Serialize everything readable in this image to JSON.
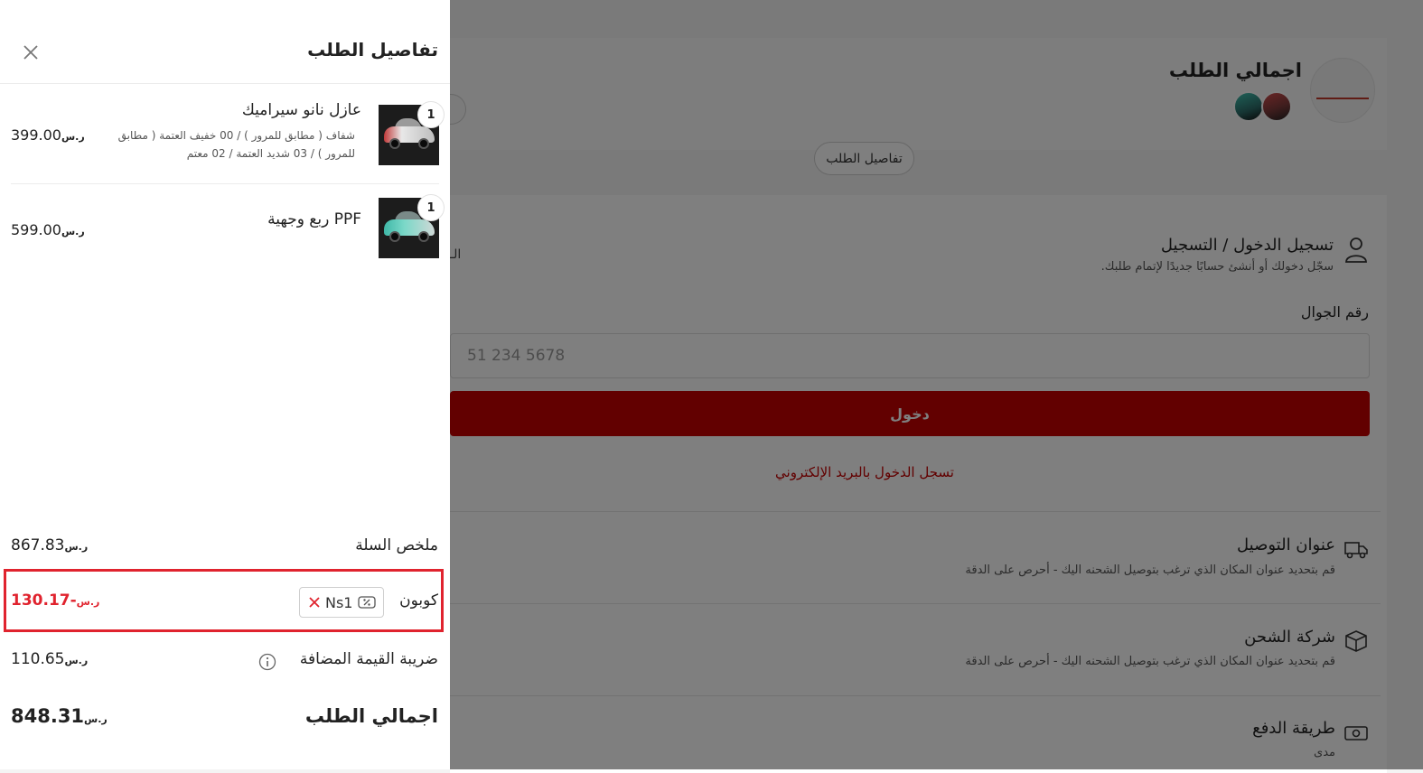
{
  "background": {
    "summary_title": "اجمالي الطلب",
    "order_details_button": "تفاصيل الطلب",
    "login": {
      "title": "تسجيل الدخول / التسجيل",
      "subtitle": "سجّل دخولك أو أنشئ حسابًا جديدًا لإتمام طلبك.",
      "phone_label": "رقم الجوال",
      "phone_placeholder": "51 234 5678",
      "login_button": "دخول",
      "email_link": "تسجل الدخول بالبريد الإلكتروني",
      "cut_text": "الـ"
    },
    "shipping_address": {
      "title": "عنوان التوصيل",
      "subtitle": "قم بتحديد عنوان المكان الذي ترغب بتوصيل الشحنه اليك - أحرص على الدقة"
    },
    "shipping_company": {
      "title": "شركة الشحن",
      "subtitle": "قم بتحديد عنوان المكان الذي ترغب بتوصيل الشحنه اليك - أحرص على الدقة"
    },
    "payment": {
      "title": "طريقة الدفع",
      "subtitle": "مدى"
    }
  },
  "drawer": {
    "title": "تفاصيل الطلب",
    "currency_symbol": "⃁",
    "items": [
      {
        "name": "عازل نانو سيراميك",
        "description": "شفاف ( مطابق للمرور ) / 00 خفيف العتمة ( مطابق للمرور ) / 03 شديد العتمة / 02 معتم",
        "price": "399.00",
        "quantity": "1",
        "image_color": "#c23a3a"
      },
      {
        "name": "PPF ربع وجهية",
        "description": "",
        "price": "599.00",
        "quantity": "1",
        "image_color": "#3fb8a8"
      }
    ],
    "summary": {
      "cart_label": "ملخص السلة",
      "cart_value": "867.83",
      "coupon_label": "كوبون",
      "coupon_code": "Ns1",
      "coupon_value": "-130.17",
      "vat_label": "ضريبة القيمة المضافة",
      "vat_value": "110.65",
      "total_label": "اجمالي الطلب",
      "total_value": "848.31"
    }
  },
  "colors": {
    "primary": "#c40000",
    "coupon_highlight": "#e0232e"
  }
}
